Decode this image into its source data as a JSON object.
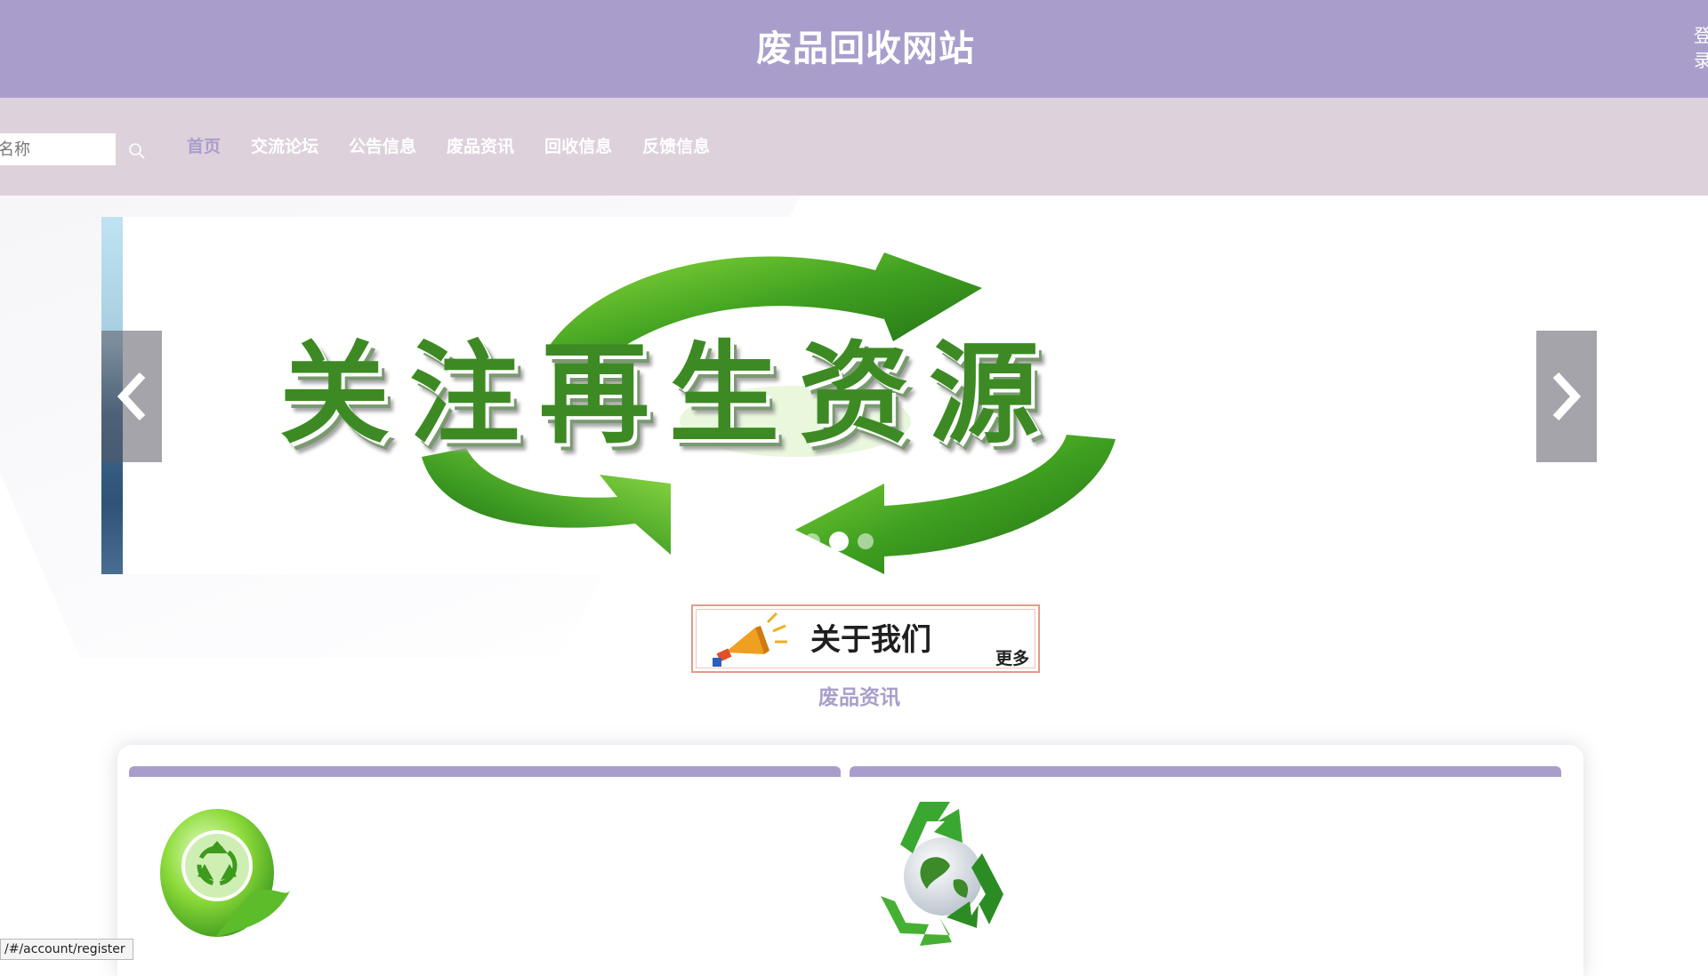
{
  "header": {
    "site_title": "废品回收网站",
    "login_label": "登录"
  },
  "nav": {
    "search_placeholder": "名称",
    "items": [
      {
        "label": "首页",
        "active": true
      },
      {
        "label": "交流论坛"
      },
      {
        "label": "公告信息"
      },
      {
        "label": "废品资讯"
      },
      {
        "label": "回收信息"
      },
      {
        "label": "反馈信息"
      }
    ]
  },
  "carousel": {
    "banner_text": "关注再生资源",
    "slide_count": 3,
    "active_index": 1
  },
  "about": {
    "title": "关于我们",
    "more_label": "更多"
  },
  "section": {
    "title": "废品资讯"
  },
  "status_bar": {
    "url": "/#/account/register"
  },
  "colors": {
    "header_bg": "#a99ecb",
    "nav_bg": "#ddd1dc",
    "accent": "#a99ecb",
    "banner_green": "#3d8a24",
    "section_underline": "#f2b0d0"
  },
  "icons": {
    "search": "magnifier-icon",
    "prev": "chevron-left-icon",
    "next": "chevron-right-icon",
    "about": "megaphone-icon",
    "card1": "recycle-leaf-icon",
    "card2": "recycle-globe-icon"
  }
}
